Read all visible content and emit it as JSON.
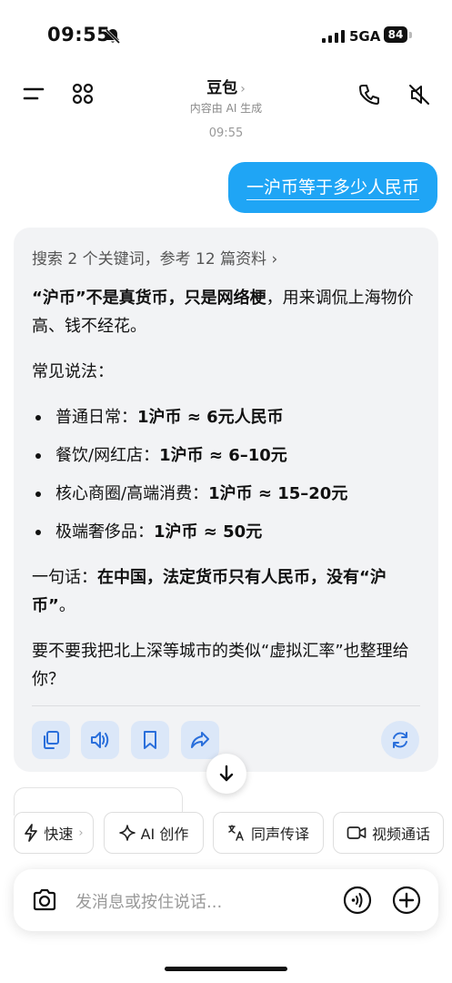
{
  "status": {
    "time": "09:55",
    "network": "5GA",
    "battery": "84"
  },
  "header": {
    "title": "豆包",
    "title_chevron": "›",
    "subtitle": "内容由 AI 生成",
    "timestamp": "09:55"
  },
  "user_message": "一沪币等于多少人民币",
  "bot_message": {
    "search_summary": "搜索 2 个关键词，参考 12 篇资料 ›",
    "p1_bold": "“沪币”不是真货币，只是网络梗",
    "p1_rest": "，用来调侃上海物价高、钱不经花。",
    "p2": "常见说法：",
    "items": [
      {
        "label": "普通日常：",
        "value": "1沪币 ≈ 6元人民币"
      },
      {
        "label": "餐饮/网红店：",
        "value": "1沪币 ≈ 6–10元"
      },
      {
        "label": "核心商圈/高端消费：",
        "value": "1沪币 ≈ 15–20元"
      },
      {
        "label": "极端奢侈品：",
        "value": "1沪币 ≈ 50元"
      }
    ],
    "p3_lead": "一句话：",
    "p3_bold": "在中国，法定货币只有人民币，没有“沪币”",
    "p3_end": "。",
    "p4": "要不要我把北上深等城市的类似“虚拟汇率”也整理给你？"
  },
  "actions": [
    "copy-icon",
    "speaker-icon",
    "bookmark-icon",
    "share-icon",
    "refresh-icon"
  ],
  "chips": [
    {
      "label": "快速",
      "icon": "lightning-icon",
      "chevron": "›"
    },
    {
      "label": "AI 创作",
      "icon": "sparkle-icon"
    },
    {
      "label": "同声传译",
      "icon": "translate-icon"
    },
    {
      "label": "视频通话",
      "icon": "video-icon"
    }
  ],
  "input": {
    "placeholder": "发消息或按住说话..."
  },
  "colors": {
    "accent": "#1fa5f5",
    "action_bg": "#dbe7f8",
    "action_icon": "#2a6fdb",
    "card_bg": "#f2f3f5"
  }
}
